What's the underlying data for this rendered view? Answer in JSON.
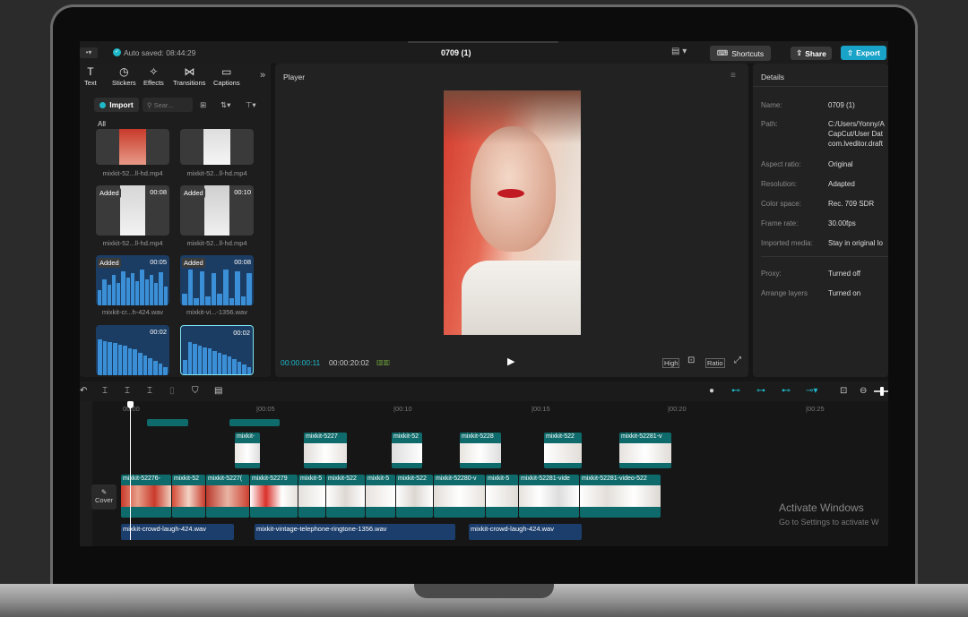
{
  "topbar": {
    "autosave": "Auto saved: 08:44:29",
    "project_title": "0709 (1)",
    "shortcuts_label": "Shortcuts",
    "share_label": "Share",
    "export_label": "Export"
  },
  "toolbar": {
    "items": [
      {
        "label": "Text",
        "icon": "text-icon"
      },
      {
        "label": "Stickers",
        "icon": "sticker-icon"
      },
      {
        "label": "Effects",
        "icon": "effects-icon"
      },
      {
        "label": "Transitions",
        "icon": "transitions-icon"
      },
      {
        "label": "Captions",
        "icon": "captions-icon"
      }
    ]
  },
  "media": {
    "import_label": "Import",
    "search_placeholder": "Sear...",
    "filter_all": "All",
    "items": [
      {
        "name": "mixkit-52...ll-hd.mp4",
        "badge": "",
        "duration": ""
      },
      {
        "name": "mixkit-52...ll-hd.mp4",
        "badge": "",
        "duration": ""
      },
      {
        "name": "mixkit-52...ll-hd.mp4",
        "badge": "Added",
        "duration": "00:08"
      },
      {
        "name": "mixkit-52...ll-hd.mp4",
        "badge": "Added",
        "duration": "00:10"
      },
      {
        "name": "mixkit-cr...h-424.wav",
        "badge": "Added",
        "duration": "00:05"
      },
      {
        "name": "mixkit-vi...-1356.wav",
        "badge": "Added",
        "duration": "00:08"
      },
      {
        "name": "",
        "badge": "",
        "duration": "00:02"
      },
      {
        "name": "",
        "badge": "",
        "duration": "00:02"
      }
    ]
  },
  "player": {
    "title": "Player",
    "current_time": "00:00:00:11",
    "total_time": "00:00:20:02",
    "quality": "High",
    "ratio": "Ratio"
  },
  "details": {
    "title": "Details",
    "rows": [
      {
        "label": "Name:",
        "value": "0709 (1)"
      },
      {
        "label": "Path:",
        "value": "C:/Users/Yonny/A"
      },
      {
        "label": "",
        "value": "CapCut/User Dat"
      },
      {
        "label": "",
        "value": "com.lveditor.draft"
      },
      {
        "label": "Aspect ratio:",
        "value": "Original"
      },
      {
        "label": "Resolution:",
        "value": "Adapted"
      },
      {
        "label": "Color space:",
        "value": "Rec. 709 SDR"
      },
      {
        "label": "Frame rate:",
        "value": "30.00fps"
      },
      {
        "label": "Imported media:",
        "value": "Stay in original lo"
      },
      {
        "label": "Proxy:",
        "value": "Turned off"
      },
      {
        "label": "Arrange layers",
        "value": "Turned on"
      }
    ]
  },
  "timeline": {
    "ticks": [
      "00:00",
      "|00:05",
      "|00:10",
      "|00:15",
      "|00:20",
      "|00:25"
    ],
    "overlay_clips": [
      "mixkit-",
      "mixkit-5227",
      "mixkit-52",
      "mixkit-5228",
      "mixkit-522",
      "mixkit-52281-v"
    ],
    "main_clips": [
      "mixkit-52276-",
      "mixkit-52",
      "mixkit-5227(",
      "mixkit-52279",
      "mixkit-5",
      "mixkit-522",
      "mixkit-5",
      "mixkit-522",
      "mixkit-52280-v",
      "mixkit-5",
      "mixkit-52281-vide",
      "mixkit-52281-video-522"
    ],
    "cover_label": "Cover",
    "audio_clips": [
      "mixkit-crowd-laugh-424.wav",
      "mixkit-vintage-telephone-ringtone-1356.wav",
      "mixkit-crowd-laugh-424.wav"
    ]
  },
  "watermark": {
    "title": "Activate Windows",
    "subtitle": "Go to Settings to activate W"
  },
  "colors": {
    "accent": "#1fb8c9",
    "export": "#1aa3c9",
    "clip": "#0f6b6b",
    "audio": "#1b3e6d"
  }
}
